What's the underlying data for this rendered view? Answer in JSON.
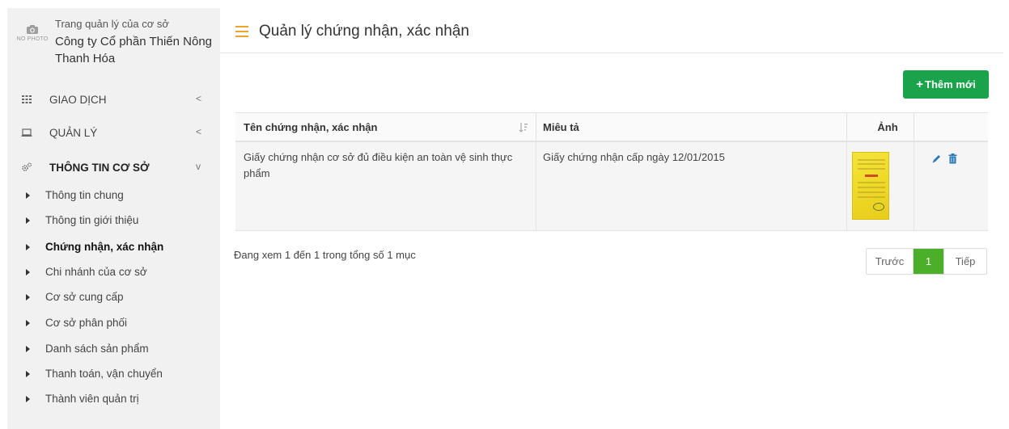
{
  "sidebar": {
    "no_photo_label": "NO PHOTO",
    "brand_subtitle": "Trang quản lý của cơ sở",
    "brand_name": "Công ty Cổ phần Thiến Nông Thanh Hóa",
    "menu": [
      {
        "label": "GIAO DỊCH",
        "icon": "grid-icon",
        "chevron": "<"
      },
      {
        "label": "QUẢN LÝ",
        "icon": "laptop-icon",
        "chevron": "<"
      },
      {
        "label": "THÔNG TIN CƠ SỞ",
        "icon": "gears-icon",
        "chevron": "v"
      }
    ],
    "sub_items": [
      {
        "label": "Thông tin chung"
      },
      {
        "label": "Thông tin giới thiệu"
      },
      {
        "label": "Chứng nhận, xác nhận"
      },
      {
        "label": "Chi nhánh của cơ sở"
      },
      {
        "label": "Cơ sở cung cấp"
      },
      {
        "label": "Cơ sở phân phối"
      },
      {
        "label": "Danh sách sản phẩm"
      },
      {
        "label": "Thanh toán, vận chuyển"
      },
      {
        "label": "Thành viên quản trị"
      }
    ]
  },
  "header": {
    "title": "Quản lý chứng nhận, xác nhận",
    "menu_icon": "hamburger-icon"
  },
  "toolbar": {
    "add_label": "Thêm mới"
  },
  "table": {
    "columns": [
      "Tên chứng nhận, xác nhận",
      "Miêu tả",
      "Ảnh",
      ""
    ],
    "rows": [
      {
        "name": "Giấy chứng nhận cơ sở đủ điều kiện an toàn vệ sinh thực phẩm",
        "description": "Giấy chứng nhận cấp ngày 12/01/2015"
      }
    ]
  },
  "footer": {
    "info": "Đang xem 1 đến 1 trong tổng số 1 mục",
    "prev": "Trước",
    "page": "1",
    "next": "Tiếp"
  },
  "colors": {
    "accent_green": "#1aa34a",
    "pager_active": "#4caf2a",
    "hamburger": "#f0a32a",
    "edit_icon": "#2a7ab8"
  }
}
